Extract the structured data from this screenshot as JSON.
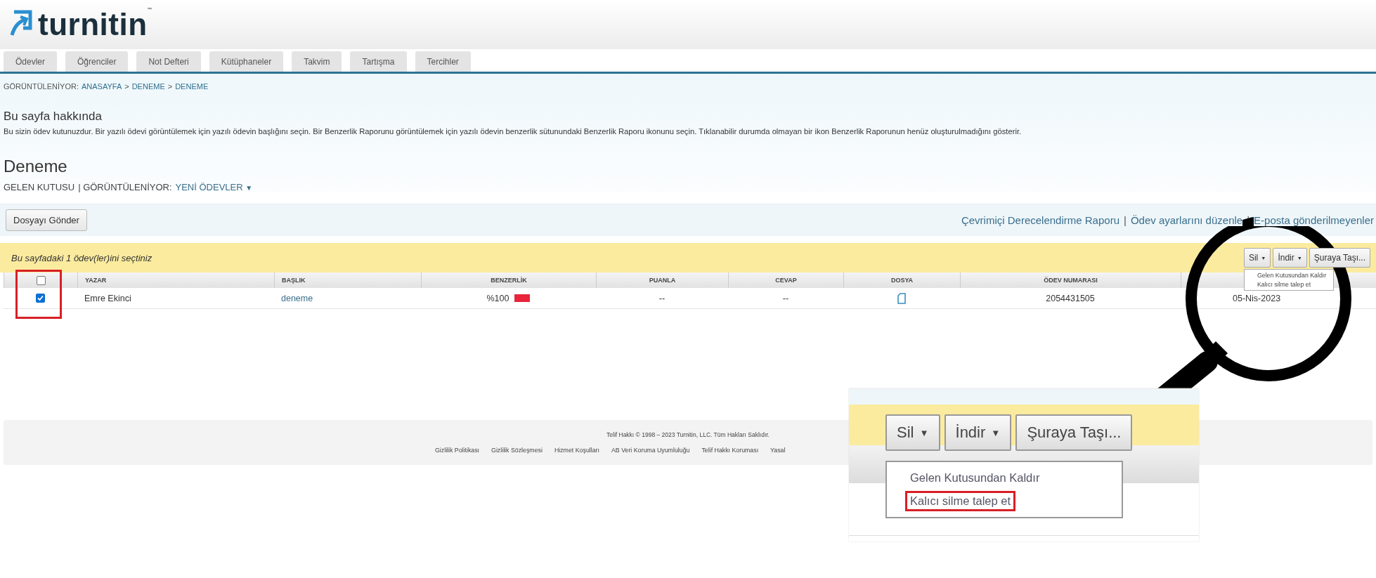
{
  "logo": {
    "text": "turnitin",
    "mark": "™"
  },
  "tabs": [
    {
      "label": "Ödevler"
    },
    {
      "label": "Öğrenciler"
    },
    {
      "label": "Not Defteri"
    },
    {
      "label": "Kütüphaneler"
    },
    {
      "label": "Takvim"
    },
    {
      "label": "Tartışma"
    },
    {
      "label": "Tercihler"
    }
  ],
  "breadcrumb": {
    "prefix": "GÖRÜNTÜLENİYOR:",
    "separator": ">",
    "items": [
      "ANASAYFA",
      "DENEME",
      "DENEME"
    ]
  },
  "about": {
    "title": "Bu sayfa hakkında",
    "text": "Bu sizin ödev kutunuzdur. Bir yazılı ödevi görüntülemek için yazılı ödevin başlığını seçin. Bir Benzerlik Raporunu görüntülemek için yazılı ödevin benzerlik sütunundaki Benzerlik Raporu ikonunu seçin. Tıklanabilir durumda olmayan bir ikon Benzerlik Raporunun henüz oluşturulmadığını gösterir."
  },
  "assignment": {
    "title": "Deneme",
    "inbox": "GELEN KUTUSU",
    "viewing_label": "| GÖRÜNTÜLENİYOR:",
    "viewing_value": "YENİ ÖDEVLER",
    "caret": "▼"
  },
  "toolbar": {
    "submit_button": "Dosyayı Gönder",
    "separator": "|",
    "links": [
      "Çevrimiçi Derecelendirme Raporu",
      "Ödev ayarlarını düzenle",
      "E-posta gönderilmeyenler"
    ]
  },
  "selection_bar": {
    "message": "Bu sayfadaki 1 ödev(ler)ini seçtiniz",
    "buttons": [
      {
        "label": "Sil",
        "caret": "▼"
      },
      {
        "label": "İndir",
        "caret": "▼"
      },
      {
        "label": "Şuraya Taşı..."
      }
    ]
  },
  "delete_menu": {
    "items": [
      "Gelen Kutusundan Kaldır",
      "Kalıcı silme talep et"
    ]
  },
  "table": {
    "header_checked": false,
    "columns": [
      "YAZAR",
      "BAŞLIK",
      "BENZERLİK",
      "PUANLA",
      "CEVAP",
      "DOSYA",
      "ÖDEV NUMARASI"
    ],
    "rows": [
      {
        "checked": true,
        "author": "Emre Ekinci",
        "title": "deneme",
        "similarity": "%100",
        "color": "#e8253a",
        "grade": "--",
        "response": "--",
        "paper_id": "2054431505",
        "date": "05-Nis-2023"
      }
    ]
  },
  "footer": {
    "copyright": "Telif Hakkı © 1998 – 2023 Turnitin, LLC. Tüm Hakları Saklıdır.",
    "links": [
      "Gizlilik Politikası",
      "Gizlilik Sözleşmesi",
      "Hizmet Koşulları",
      "AB Veri Koruma Uyumluluğu",
      "Telif Hakkı Koruması",
      "Yasal"
    ]
  },
  "annotations": {
    "checkbox_highlight": true,
    "inset": {
      "buttons": [
        {
          "label": "Sil",
          "caret": "▼"
        },
        {
          "label": "İndir",
          "caret": "▼"
        },
        {
          "label": "Şuraya Taşı..."
        }
      ],
      "menu_items": [
        {
          "label": "Gelen Kutusundan Kaldır",
          "highlighted": false
        },
        {
          "label": "Kalıcı silme talep et",
          "highlighted": true
        }
      ]
    }
  }
}
